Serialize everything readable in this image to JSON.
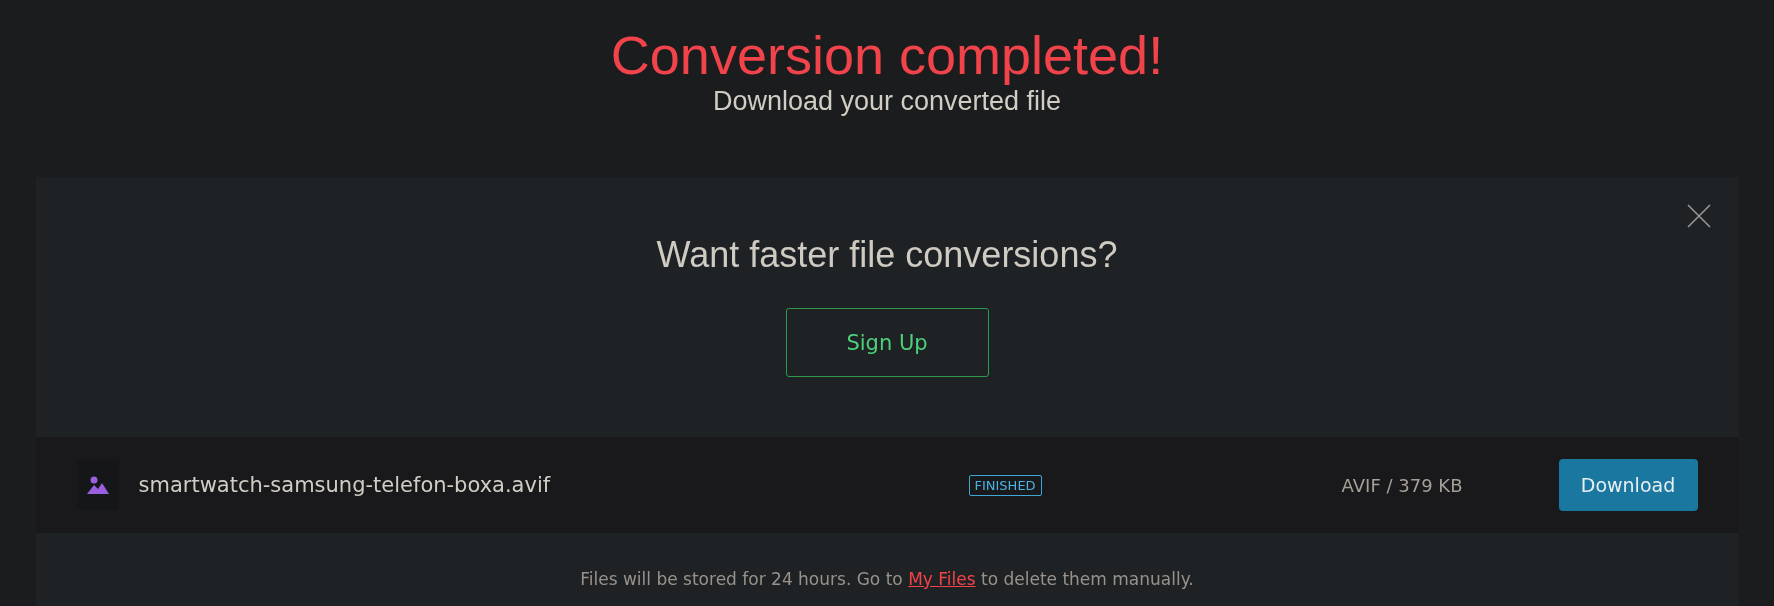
{
  "header": {
    "title": "Conversion completed!",
    "subtitle": "Download your converted file"
  },
  "promo": {
    "heading": "Want faster file conversions?",
    "button": "Sign Up"
  },
  "files": [
    {
      "name": "smartwatch-samsung-telefon-boxa.avif",
      "status": "FINISHED",
      "info": "AVIF / 379 KB",
      "button": "Download"
    }
  ],
  "footer": {
    "text": "Files will be stored for 24 hours. Go to ",
    "link": "My Files",
    "after": " to delete them manually."
  }
}
